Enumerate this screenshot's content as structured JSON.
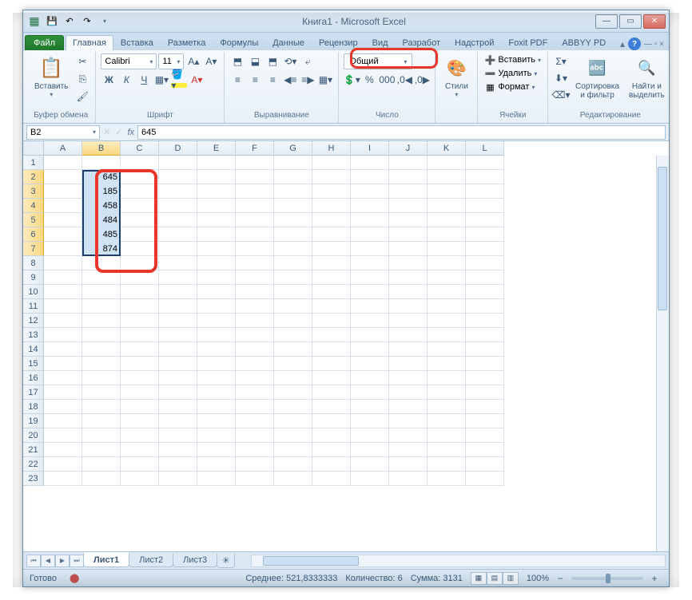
{
  "window": {
    "title": "Книга1 - Microsoft Excel"
  },
  "qat": {
    "save": "💾",
    "undo": "↶",
    "redo": "↷"
  },
  "tabs": {
    "file": "Файл",
    "home": "Главная",
    "insert": "Вставка",
    "layout": "Разметка",
    "formulas": "Формулы",
    "data": "Данные",
    "review": "Рецензир",
    "view": "Вид",
    "developer": "Разработ",
    "addins": "Надстрой",
    "foxit": "Foxit PDF",
    "abbyy": "ABBYY PD"
  },
  "ribbon": {
    "clipboard": {
      "label": "Буфер обмена",
      "paste": "Вставить"
    },
    "font": {
      "label": "Шрифт",
      "name": "Calibri",
      "size": "11",
      "bold": "Ж",
      "italic": "К",
      "underline": "Ч"
    },
    "alignment": {
      "label": "Выравнивание"
    },
    "number": {
      "label": "Число",
      "format": "Общий"
    },
    "styles": {
      "label": "Стили",
      "styles_btn": "Стили"
    },
    "cells": {
      "label": "Ячейки",
      "insert": "Вставить",
      "delete": "Удалить",
      "format": "Формат"
    },
    "editing": {
      "label": "Редактирование",
      "sort": "Сортировка\nи фильтр",
      "find": "Найти и\nвыделить"
    }
  },
  "namebox": "B2",
  "formula": "645",
  "columns": [
    "A",
    "B",
    "C",
    "D",
    "E",
    "F",
    "G",
    "H",
    "I",
    "J",
    "K",
    "L"
  ],
  "rows": [
    "1",
    "2",
    "3",
    "4",
    "5",
    "6",
    "7",
    "8",
    "9",
    "10",
    "11",
    "12",
    "13",
    "14",
    "15",
    "16",
    "17",
    "18",
    "19",
    "20",
    "21",
    "22",
    "23"
  ],
  "cell_data": {
    "B2": "645",
    "B3": "185",
    "B4": "458",
    "B5": "484",
    "B6": "485",
    "B7": "874"
  },
  "sheets": {
    "s1": "Лист1",
    "s2": "Лист2",
    "s3": "Лист3"
  },
  "status": {
    "ready": "Готово",
    "avg_label": "Среднее:",
    "avg": "521,8333333",
    "count_label": "Количество:",
    "count": "6",
    "sum_label": "Сумма:",
    "sum": "3131",
    "zoom": "100%"
  }
}
